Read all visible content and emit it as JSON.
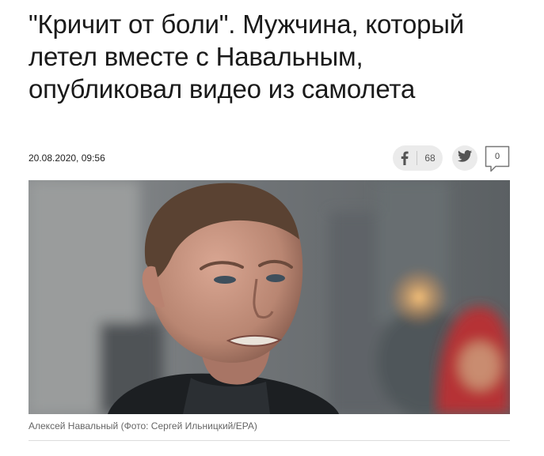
{
  "article": {
    "headline": "\"Кричит от боли\". Мужчина, который летел вместе с Навальным, опубликовал видео из самолета",
    "datetime": "20.08.2020, 09:56",
    "photo_caption": "Алексей Навальный (Фото: Сергей Ильницкий/EPA)"
  },
  "share": {
    "facebook_icon": "facebook-icon",
    "facebook_count": "68",
    "twitter_icon": "twitter-icon",
    "comments_icon": "comment-bubble-icon",
    "comments_count": "0"
  },
  "colors": {
    "share_button_bg": "#ebebeb",
    "icon_gray": "#555555",
    "caption_gray": "#666666"
  }
}
